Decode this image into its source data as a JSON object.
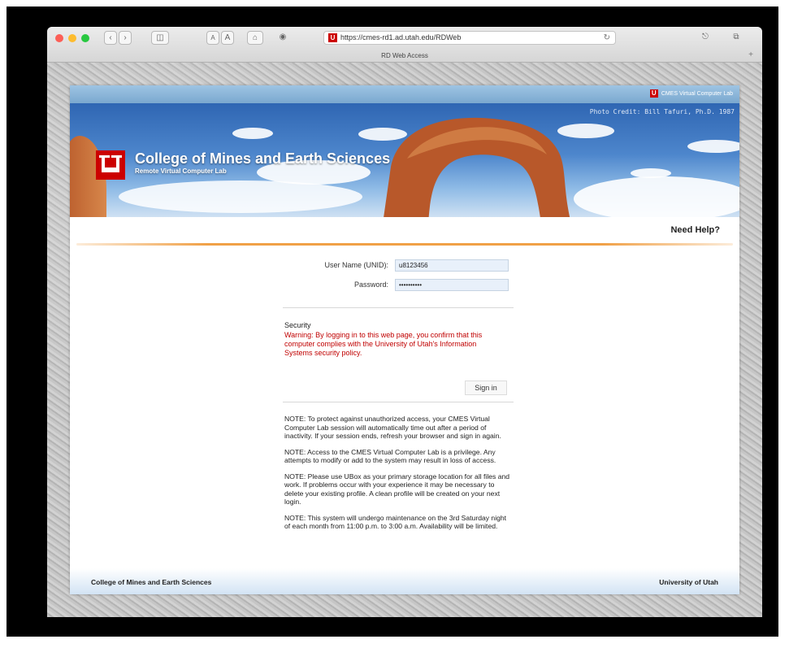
{
  "browser": {
    "url": "https://cmes-rd1.ad.utah.edu/RDWeb",
    "tab_title": "RD Web Access",
    "text_size_small": "A",
    "text_size_large": "A",
    "tab_plus": "+"
  },
  "header": {
    "top_link": "CMES Virtual Computer Lab",
    "photo_credit": "Photo Credit: Bill Tafuri, Ph.D. 1987",
    "title": "College of Mines and Earth Sciences",
    "subtitle": "Remote Virtual Computer Lab",
    "help": "Need Help?"
  },
  "form": {
    "username_label": "User Name (UNID):",
    "username_value": "u8123456",
    "password_label": "Password:",
    "password_value": "••••••••••",
    "signin_label": "Sign in"
  },
  "security": {
    "title": "Security",
    "warning": "Warning: By logging in to this web page, you confirm that this computer complies with the University of Utah's Information Systems security policy."
  },
  "notes": [
    "NOTE: To protect against unauthorized access, your CMES Virtual Computer Lab session will automatically time out after a period of inactivity. If your session ends, refresh your browser and sign in again.",
    "NOTE: Access to the CMES Virtual Computer Lab is a privilege. Any attempts to modify or add to the system may result in loss of access.",
    "NOTE: Please use UBox as your primary storage location for all files and work. If problems occur with your experience it may be necessary to delete your existing profile. A clean profile will be created on your next login.",
    "NOTE: This system will undergo maintenance on the 3rd Saturday night of each month from 11:00 p.m. to 3:00 a.m. Availability will be limited."
  ],
  "footer": {
    "left": "College of Mines and Earth Sciences",
    "right": "University of Utah"
  },
  "colors": {
    "utah_red": "#cc0000",
    "warning_red": "#c00000",
    "accent_orange": "#f0a046",
    "header_blue": "#7aa8cf"
  }
}
